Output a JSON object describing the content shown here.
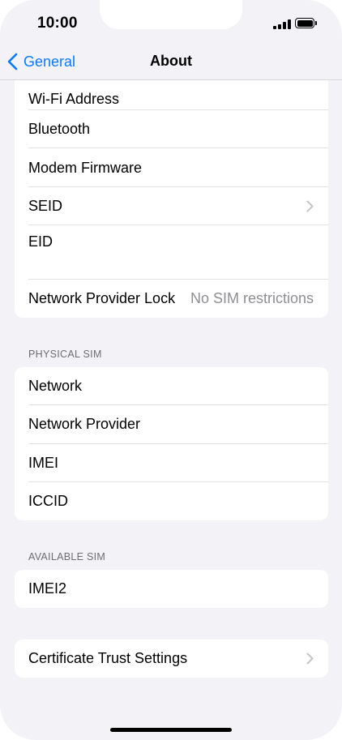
{
  "status_bar": {
    "time": "10:00"
  },
  "nav": {
    "back_label": "General",
    "title": "About"
  },
  "group1": {
    "wifi_address_label": "Wi-Fi Address",
    "bluetooth_label": "Bluetooth",
    "modem_firmware_label": "Modem Firmware",
    "seid_label": "SEID",
    "eid_label": "EID",
    "network_provider_lock_label": "Network Provider Lock",
    "network_provider_lock_value": "No SIM restrictions"
  },
  "physical_sim": {
    "header": "PHYSICAL SIM",
    "network_label": "Network",
    "network_provider_label": "Network Provider",
    "imei_label": "IMEI",
    "iccid_label": "ICCID"
  },
  "available_sim": {
    "header": "AVAILABLE SIM",
    "imei2_label": "IMEI2"
  },
  "certificate": {
    "label": "Certificate Trust Settings"
  },
  "colors": {
    "accent": "#0a7aff",
    "background": "#f2f2f7",
    "secondary_text": "#8e8e93"
  }
}
